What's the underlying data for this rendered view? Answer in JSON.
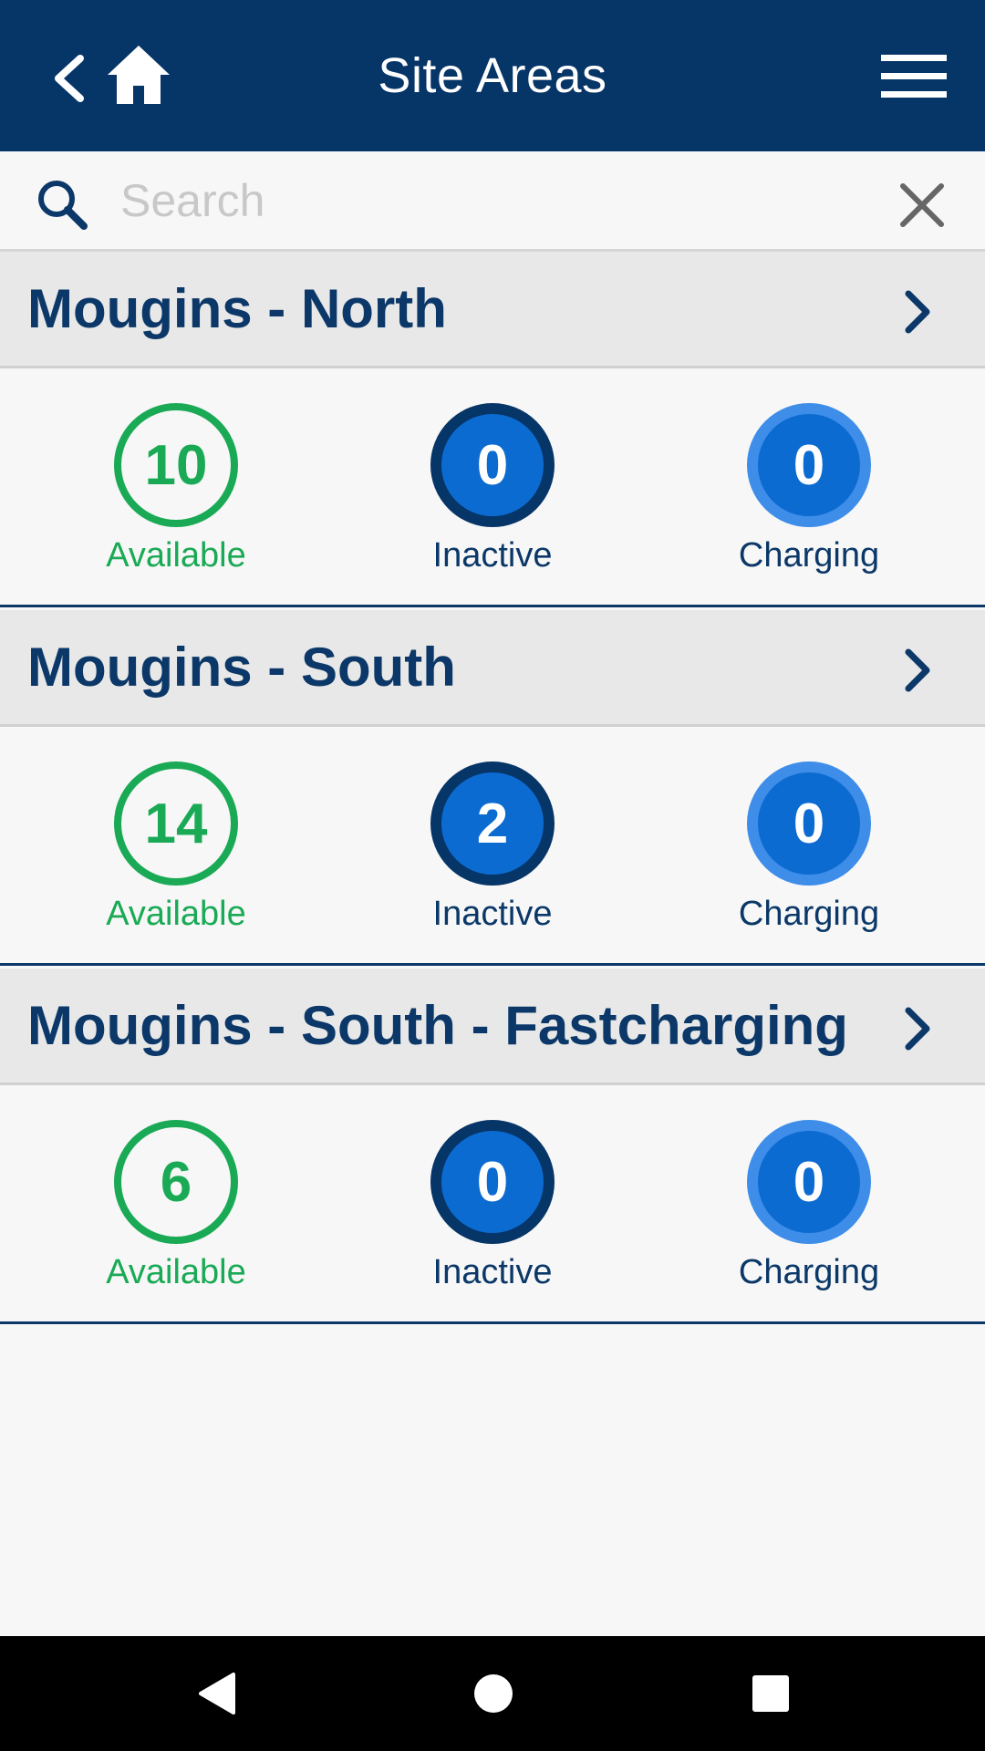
{
  "header": {
    "title": "Site Areas"
  },
  "search": {
    "placeholder": "Search",
    "value": ""
  },
  "site_areas": [
    {
      "name": "Mougins - North",
      "available": "10",
      "available_label": "Available",
      "inactive": "0",
      "inactive_label": "Inactive",
      "charging": "0",
      "charging_label": "Charging"
    },
    {
      "name": "Mougins - South",
      "available": "14",
      "available_label": "Available",
      "inactive": "2",
      "inactive_label": "Inactive",
      "charging": "0",
      "charging_label": "Charging"
    },
    {
      "name": "Mougins - South - Fastcharging",
      "available": "6",
      "available_label": "Available",
      "inactive": "0",
      "inactive_label": "Inactive",
      "charging": "0",
      "charging_label": "Charging"
    }
  ],
  "colors": {
    "header_bg": "#063567",
    "available": "#1aaa55",
    "inactive_ring": "#063567",
    "charging_ring": "#3d8de9",
    "badge_fill": "#0c6bd1",
    "title_text": "#0b3868"
  },
  "icons": {
    "back": "chevron-left-icon",
    "home": "home-icon",
    "menu": "hamburger-menu-icon",
    "search": "search-icon",
    "clear": "close-icon",
    "row_chevron": "chevron-right-icon",
    "nav_back": "triangle-back-icon",
    "nav_home": "circle-home-icon",
    "nav_recents": "square-recents-icon"
  }
}
